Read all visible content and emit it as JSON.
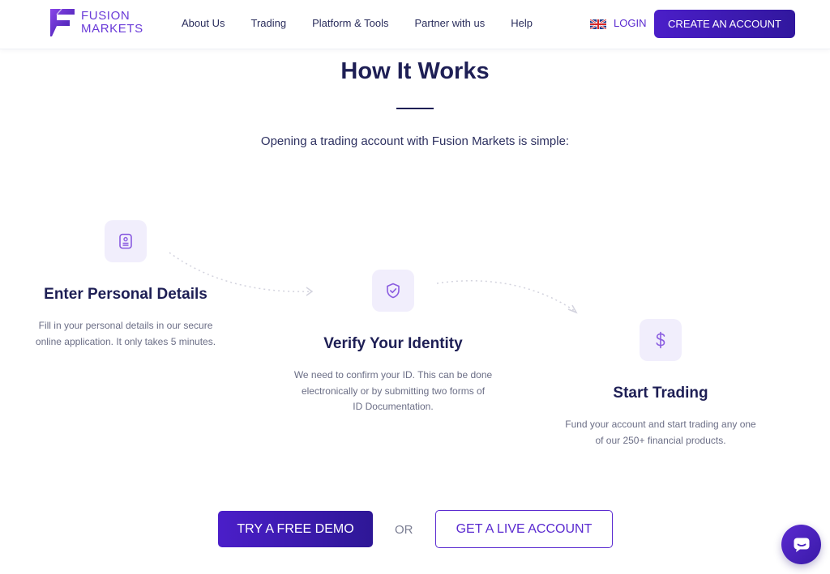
{
  "header": {
    "logo_line1": "FUSION",
    "logo_line2": "MARKETS",
    "nav": [
      "About Us",
      "Trading",
      "Platform & Tools",
      "Partner with us",
      "Help"
    ],
    "language_icon": "uk-flag-icon",
    "login_label": "LOGIN",
    "create_account_label": "CREATE AN ACCOUNT"
  },
  "section": {
    "title": "How It Works",
    "intro": "Opening a trading account with Fusion Markets is simple:"
  },
  "steps": [
    {
      "icon": "document-icon",
      "title": "Enter Personal Details",
      "desc_line1": "Fill in your personal details in our secure",
      "desc_line2": "online application. It only takes 5 minutes."
    },
    {
      "icon": "shield-check-icon",
      "title": "Verify Your Identity",
      "desc_line1": "We need to confirm your ID. This can be done",
      "desc_line2": "electronically or by submitting two forms of",
      "desc_line3": "ID Documentation."
    },
    {
      "icon": "dollar-icon",
      "title": "Start Trading",
      "desc_line1": "Fund your account and start trading any one",
      "desc_line2": "of our 250+ financial products."
    }
  ],
  "cta": {
    "demo_label": "TRY A FREE DEMO",
    "or_label": "OR",
    "live_label": "GET A LIVE ACCOUNT"
  },
  "colors": {
    "brand_purple": "#5a2ad0",
    "brand_dark": "#1e1f55",
    "icon_bg": "#f1eefc"
  },
  "chat_icon": "chat-icon"
}
